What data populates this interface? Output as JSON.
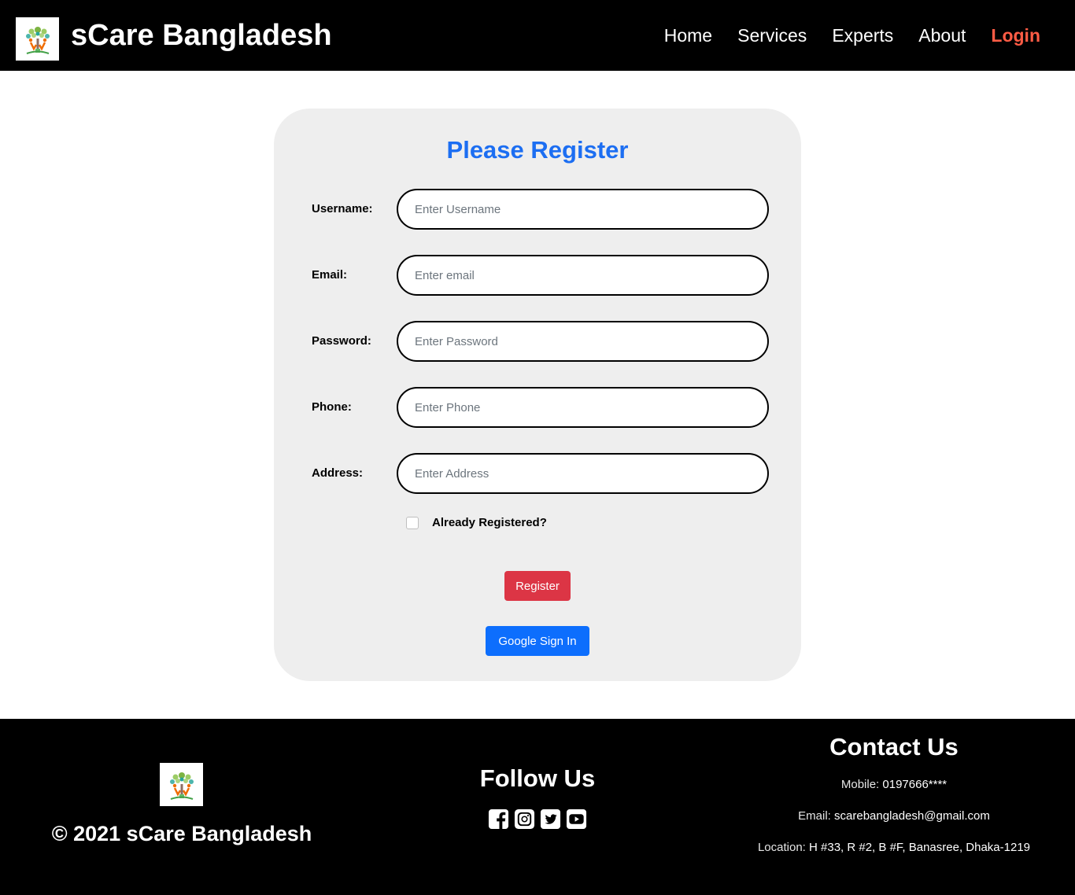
{
  "navbar": {
    "brand": "sCare Bangladesh",
    "links": [
      "Home",
      "Services",
      "Experts",
      "About"
    ],
    "login": "Login",
    "login_color": "#ff5c45"
  },
  "form": {
    "title": "Please Register",
    "fields": [
      {
        "label": "Username:",
        "placeholder": "Enter Username"
      },
      {
        "label": "Email:",
        "placeholder": "Enter email"
      },
      {
        "label": "Password:",
        "placeholder": "Enter Password"
      },
      {
        "label": "Phone:",
        "placeholder": "Enter Phone"
      },
      {
        "label": "Address:",
        "placeholder": "Enter Address"
      }
    ],
    "checkbox_label": "Already Registered?",
    "checkbox_checked": false,
    "register_button": "Register",
    "google_button": "Google Sign In",
    "title_color": "#1c6ef2",
    "register_color": "#dc3545",
    "google_color": "#0d6efd"
  },
  "footer": {
    "copyright": "© 2021 sCare Bangladesh",
    "follow_title": "Follow Us",
    "social_icons": [
      "facebook-icon",
      "instagram-icon",
      "twitter-icon",
      "youtube-icon"
    ],
    "contact_title": "Contact Us",
    "mobile_label": "Mobile:",
    "mobile": "0197666****",
    "email_label": "Email:",
    "email": "scarebangladesh@gmail.com",
    "location_label": "Location:",
    "location": "H #33, R #2, B #F, Banasree, Dhaka-1219"
  }
}
